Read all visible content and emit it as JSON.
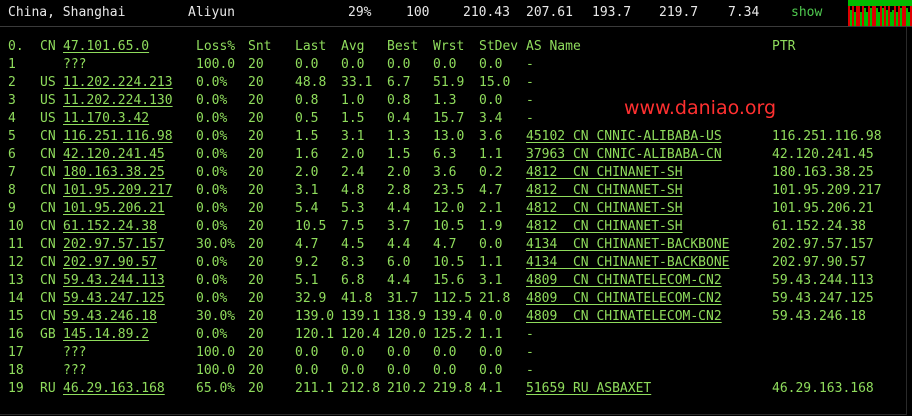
{
  "topbar": {
    "location": "China, Shanghai",
    "provider": "Aliyun",
    "loss": "29%",
    "sent": "100",
    "v1": "210.43",
    "v2": "207.61",
    "v3": "193.7",
    "v4": "219.7",
    "v5": "7.34",
    "toggle": "show"
  },
  "watermark": "www.daniao.org",
  "colors": {
    "text": "#8fdc5c",
    "background": "#000000",
    "watermark": "#ff3030",
    "graph_green": "#00bb00",
    "graph_red": "#dd0000"
  },
  "table": {
    "headers": [
      "0.",
      "CN",
      "47.101.65.0",
      "Loss%",
      "Snt",
      "Last",
      "Avg",
      "Best",
      "Wrst",
      "StDev",
      "AS Name",
      "PTR"
    ],
    "rows": [
      [
        "1",
        "",
        "???",
        "100.0",
        "20",
        "0.0",
        "0.0",
        "0.0",
        "0.0",
        "0.0",
        "-",
        ""
      ],
      [
        "2",
        "US",
        "11.202.224.213",
        "0.0%",
        "20",
        "48.8",
        "33.1",
        "6.7",
        "51.9",
        "15.0",
        "-",
        ""
      ],
      [
        "3",
        "US",
        "11.202.224.130",
        "0.0%",
        "20",
        "0.8",
        "1.0",
        "0.8",
        "1.3",
        "0.0",
        "-",
        ""
      ],
      [
        "4",
        "US",
        "11.170.3.42",
        "0.0%",
        "20",
        "0.5",
        "1.5",
        "0.4",
        "15.7",
        "3.4",
        "-",
        ""
      ],
      [
        "5",
        "CN",
        "116.251.116.98",
        "0.0%",
        "20",
        "1.5",
        "3.1",
        "1.3",
        "13.0",
        "3.6",
        "45102 CN CNNIC-ALIBABA-US",
        "116.251.116.98"
      ],
      [
        "6",
        "CN",
        "42.120.241.45",
        "0.0%",
        "20",
        "1.6",
        "2.0",
        "1.5",
        "6.3",
        "1.1",
        "37963 CN CNNIC-ALIBABA-CN",
        "42.120.241.45"
      ],
      [
        "7",
        "CN",
        "180.163.38.25",
        "0.0%",
        "20",
        "2.0",
        "2.4",
        "2.0",
        "3.6",
        "0.2",
        "4812  CN CHINANET-SH",
        "180.163.38.25"
      ],
      [
        "8",
        "CN",
        "101.95.209.217",
        "0.0%",
        "20",
        "3.1",
        "4.8",
        "2.8",
        "23.5",
        "4.7",
        "4812  CN CHINANET-SH",
        "101.95.209.217"
      ],
      [
        "9",
        "CN",
        "101.95.206.21",
        "0.0%",
        "20",
        "5.4",
        "5.3",
        "4.4",
        "12.0",
        "2.1",
        "4812  CN CHINANET-SH",
        "101.95.206.21"
      ],
      [
        "10",
        "CN",
        "61.152.24.38",
        "0.0%",
        "20",
        "10.5",
        "7.5",
        "3.7",
        "10.5",
        "1.9",
        "4812  CN CHINANET-SH",
        "61.152.24.38"
      ],
      [
        "11",
        "CN",
        "202.97.57.157",
        "30.0%",
        "20",
        "4.7",
        "4.5",
        "4.4",
        "4.7",
        "0.0",
        "4134  CN CHINANET-BACKBONE",
        "202.97.57.157"
      ],
      [
        "12",
        "CN",
        "202.97.90.57",
        "0.0%",
        "20",
        "9.2",
        "8.3",
        "6.0",
        "10.5",
        "1.1",
        "4134  CN CHINANET-BACKBONE",
        "202.97.90.57"
      ],
      [
        "13",
        "CN",
        "59.43.244.113",
        "0.0%",
        "20",
        "5.1",
        "6.8",
        "4.4",
        "15.6",
        "3.1",
        "4809  CN CHINATELECOM-CN2",
        "59.43.244.113"
      ],
      [
        "14",
        "CN",
        "59.43.247.125",
        "0.0%",
        "20",
        "32.9",
        "41.8",
        "31.7",
        "112.5",
        "21.8",
        "4809  CN CHINATELECOM-CN2",
        "59.43.247.125"
      ],
      [
        "15",
        "CN",
        "59.43.246.18",
        "30.0%",
        "20",
        "139.0",
        "139.1",
        "138.9",
        "139.4",
        "0.0",
        "4809  CN CHINATELECOM-CN2",
        "59.43.246.18"
      ],
      [
        "16",
        "GB",
        "145.14.89.2",
        "0.0%",
        "20",
        "120.1",
        "120.4",
        "120.0",
        "125.2",
        "1.1",
        "-",
        ""
      ],
      [
        "17",
        "",
        "???",
        "100.0",
        "20",
        "0.0",
        "0.0",
        "0.0",
        "0.0",
        "0.0",
        "-",
        ""
      ],
      [
        "18",
        "",
        "???",
        "100.0",
        "20",
        "0.0",
        "0.0",
        "0.0",
        "0.0",
        "0.0",
        "-",
        ""
      ],
      [
        "19",
        "RU",
        "46.29.163.168",
        "65.0%",
        "20",
        "211.1",
        "212.8",
        "210.2",
        "219.8",
        "4.1",
        "51659 RU ASBAXET",
        "46.29.163.168"
      ]
    ]
  }
}
